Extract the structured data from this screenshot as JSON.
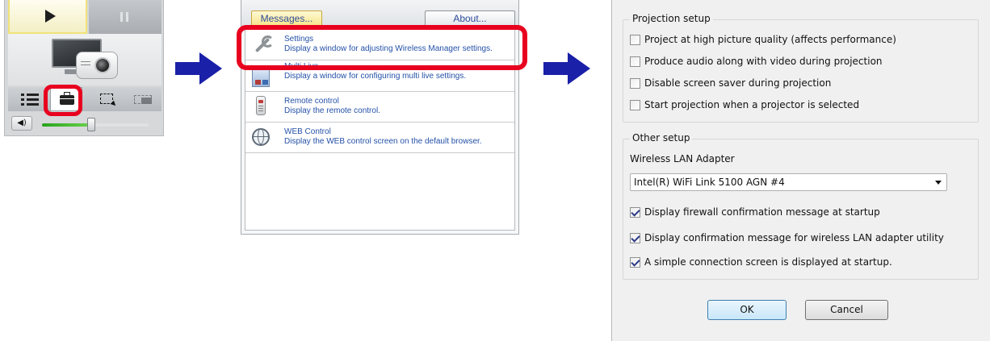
{
  "launcher": {
    "play_icon": "play-icon",
    "pause_icon": "pause-icon",
    "device_icon": "monitor-projector-icon",
    "tools": [
      "list-icon",
      "toolbox-icon",
      "select-area-icon",
      "multi-screen-icon"
    ],
    "volume_icon": "speaker-icon",
    "volume_level": 0.48
  },
  "menu": {
    "tab_messages": "Messages...",
    "tab_about": "About...",
    "items": [
      {
        "title": "Settings",
        "desc": "Display a window for adjusting Wireless Manager settings.",
        "icon": "wrench-icon"
      },
      {
        "title": "Multi Live",
        "desc": "Display a window for configuring multi live settings.",
        "icon": "multi-live-icon"
      },
      {
        "title": "Remote control",
        "desc": "Display the remote control.",
        "icon": "remote-control-icon"
      },
      {
        "title": "WEB Control",
        "desc": "Display the WEB control screen on the default browser.",
        "icon": "globe-icon"
      }
    ]
  },
  "settings": {
    "projection_legend": "Projection setup",
    "projection_options": [
      {
        "label": "Project at high picture quality (affects performance)",
        "checked": false
      },
      {
        "label": "Produce audio along with video during projection",
        "checked": false
      },
      {
        "label": "Disable screen saver during projection",
        "checked": false
      },
      {
        "label": "Start projection when a projector is selected",
        "checked": false
      }
    ],
    "other_legend": "Other setup",
    "adapter_label": "Wireless LAN Adapter",
    "adapter_value": "Intel(R) WiFi Link 5100 AGN #4",
    "other_options": [
      {
        "label": "Display firewall confirmation message at startup",
        "checked": true
      },
      {
        "label": "Display confirmation message for wireless LAN adapter utility",
        "checked": true
      },
      {
        "label": "A simple connection screen is displayed at startup.",
        "checked": true
      }
    ],
    "ok_label": "OK",
    "cancel_label": "Cancel"
  },
  "colors": {
    "highlight_red": "#e8001f",
    "arrow_blue": "#1a20a8",
    "link_blue": "#2451a8"
  }
}
